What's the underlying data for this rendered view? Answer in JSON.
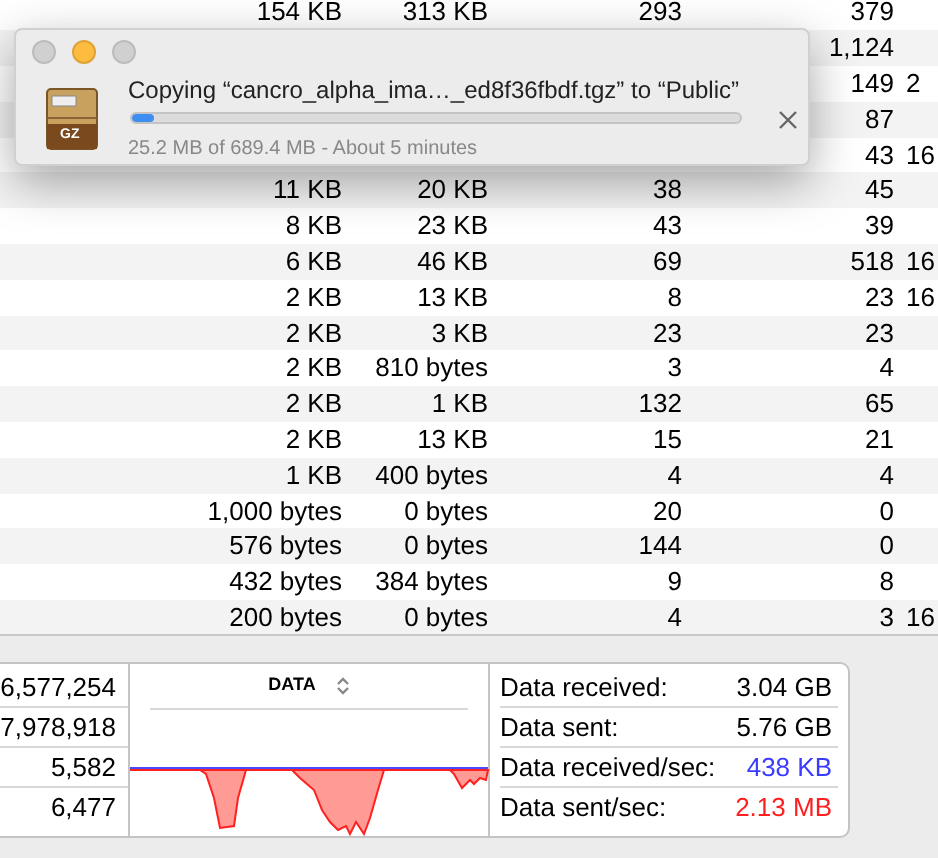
{
  "table": {
    "rows": [
      {
        "column_1": "154 KB",
        "column_2": "313 KB",
        "column_3": "293",
        "column_4": "379"
      },
      {
        "column_4": "1,124"
      },
      {
        "column_4": "149",
        "column_5": "2"
      },
      {
        "column_4": "87"
      },
      {
        "column_4": "43",
        "column_5": "16"
      },
      {
        "column_1": "11 KB",
        "column_2": "20 KB",
        "column_3": "38",
        "column_4": "45"
      },
      {
        "column_1": "8 KB",
        "column_2": "23 KB",
        "column_3": "43",
        "column_4": "39"
      },
      {
        "column_1": "6 KB",
        "column_2": "46 KB",
        "column_3": "69",
        "column_4": "518",
        "column_5": "16"
      },
      {
        "column_1": "2 KB",
        "column_2": "13 KB",
        "column_3": "8",
        "column_4": "23",
        "column_5": "16"
      },
      {
        "column_1": "2 KB",
        "column_2": "3 KB",
        "column_3": "23",
        "column_4": "23"
      },
      {
        "column_1": "2 KB",
        "column_2": "810 bytes",
        "column_3": "3",
        "column_4": "4"
      },
      {
        "column_1": "2 KB",
        "column_2": "1 KB",
        "column_3": "132",
        "column_4": "65"
      },
      {
        "column_1": "2 KB",
        "column_2": "13 KB",
        "column_3": "15",
        "column_4": "21"
      },
      {
        "column_1": "1 KB",
        "column_2": "400 bytes",
        "column_3": "4",
        "column_4": "4"
      },
      {
        "column_1": "1,000 bytes",
        "column_2": "0 bytes",
        "column_3": "20",
        "column_4": "0"
      },
      {
        "column_1": "576 bytes",
        "column_2": "0 bytes",
        "column_3": "144",
        "column_4": "0"
      },
      {
        "column_1": "432 bytes",
        "column_2": "384 bytes",
        "column_3": "9",
        "column_4": "8"
      },
      {
        "column_1": "200 bytes",
        "column_2": "0 bytes",
        "column_3": "4",
        "column_4": "3",
        "column_5": "16"
      }
    ]
  },
  "copy_dialog": {
    "window_controls": [
      {
        "enabled": false
      },
      {
        "enabled": true
      },
      {
        "enabled": false
      }
    ],
    "title": "Copying “cancro_alpha_ima…_ed8f36fbdf.tgz” to “Public”",
    "icon_label": "GZ",
    "level": 0.037,
    "status": "25.2 MB of 689.4 MB - About 5 minutes"
  },
  "summary": {
    "totals": [
      "6,577,254",
      "7,978,918",
      "5,582",
      "6,477"
    ],
    "graph": {
      "title": "DATA"
    },
    "stats": [
      {
        "label": "Data received:",
        "value": "3.04 GB",
        "color": "#000000"
      },
      {
        "label": "Data sent:",
        "value": "5.76 GB",
        "color": "#000000"
      },
      {
        "label": "Data received/sec:",
        "value": "438 KB",
        "color": "#3b3bff"
      },
      {
        "label": "Data sent/sec:",
        "value": "2.13 MB",
        "color": "#ff1f1f"
      }
    ]
  }
}
